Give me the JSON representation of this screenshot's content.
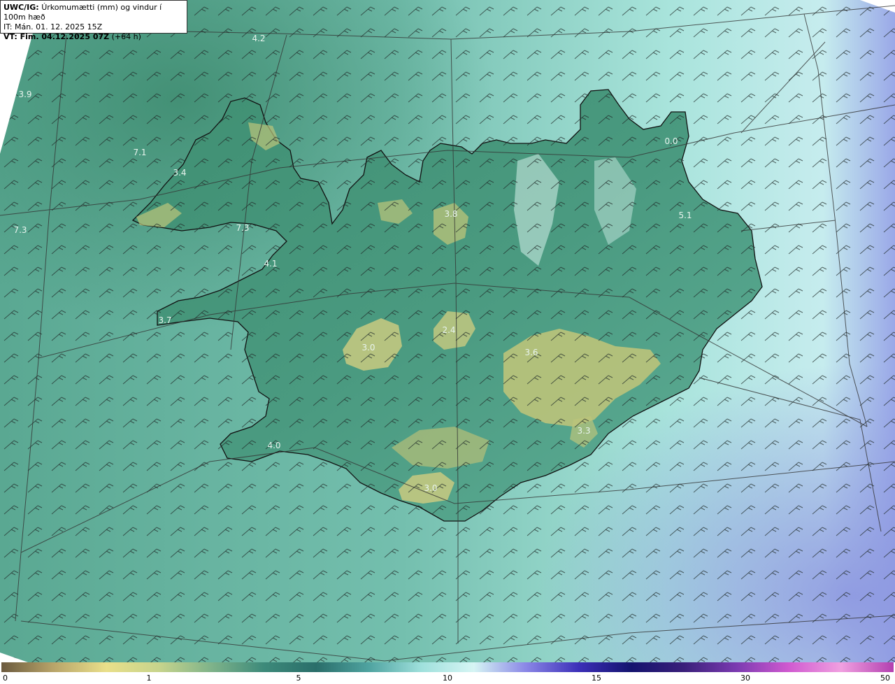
{
  "header": {
    "product": "UWC/IG:",
    "title": "Úrkomumætti (mm) og vindur í 100m hæð",
    "init_time": "IT: Mán. 01. 12. 2025 15Z",
    "valid_label": "VT: Fim. 04.12.2025 07Z",
    "lead_time": "(+64 h)"
  },
  "colorbar": {
    "ticks": [
      "0",
      "1",
      "5",
      "10",
      "15",
      "30",
      "50"
    ],
    "colors": [
      "#6b5a3e",
      "#b9a56a",
      "#e9df8a",
      "#c7d48c",
      "#7fb38a",
      "#3d8a7a",
      "#2a6e6a",
      "#4fa3a0",
      "#9fe0dc",
      "#d6f5f4",
      "#8a86e6",
      "#3c2fb8",
      "#14136e",
      "#3a1f7a",
      "#7a3ab0",
      "#d05ad0",
      "#f0a0e0",
      "#b33fb0"
    ]
  },
  "map_values": {
    "labels": [
      "4.2",
      "3.9",
      "7.1",
      "3.4",
      "7.3",
      "7.3",
      "4.1",
      "3.7",
      "3.8",
      "3.0",
      "2.4",
      "5.1",
      "0.0",
      "4.0",
      "3.3",
      "3.0",
      "3.6"
    ]
  },
  "palette": {
    "sea_light": "#9fdcd4",
    "sea_mid": "#5cb6a6",
    "land_green": "#3e8f73",
    "highland": "#c9c97a",
    "coast": "#111111",
    "grid": "#333333",
    "barb": "#1a1a1a"
  }
}
